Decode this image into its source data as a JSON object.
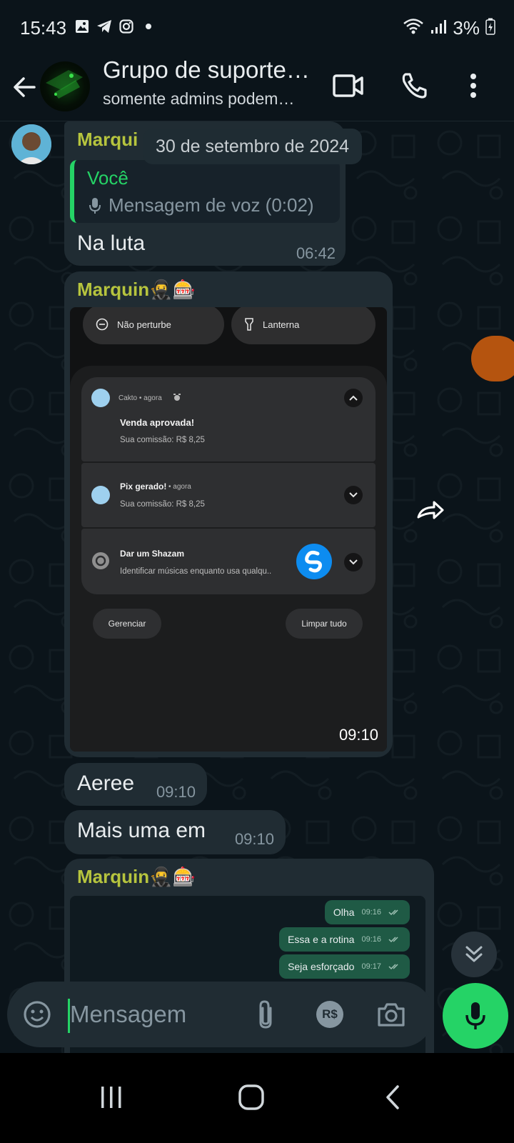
{
  "status_bar": {
    "time": "15:43",
    "battery": "3%",
    "left_icons": [
      "gallery-icon",
      "telegram-icon",
      "instagram-icon",
      "dot-icon"
    ],
    "right_icons": [
      "wifi-icon",
      "signal-icon",
      "battery-charging-icon"
    ]
  },
  "header": {
    "title": "Grupo de suporte…",
    "subtitle": "somente admins podem…",
    "actions": [
      "video-call-icon",
      "voice-call-icon",
      "more-options-icon"
    ]
  },
  "chat": {
    "date_chip": "30 de setembro de 2024",
    "msg1": {
      "sender": "Marqui",
      "quote_name": "Você",
      "quote_text": "Mensagem de voz (0:02)",
      "text": "Na luta",
      "time": "06:42"
    },
    "msg2": {
      "sender": "Marquin🥷🎰",
      "time": "09:10",
      "screenshot": {
        "tile1": "Não perturbe",
        "tile2": "Lanterna",
        "notif1_app": "Cakto • agora",
        "notif1_title": "Venda aprovada!",
        "notif1_body": "Sua comissão: R$ 8,25",
        "notif2_title": "Pix gerado!",
        "notif2_app": "• agora",
        "notif2_body": "Sua comissão: R$ 8,25",
        "notif3_title": "Dar um Shazam",
        "notif3_body": "Identificar músicas enquanto usa qualqu..",
        "manage_label": "Gerenciar",
        "clear_label": "Limpar tudo"
      }
    },
    "msg3": {
      "text": "Aeree",
      "time": "09:10"
    },
    "msg4": {
      "text": "Mais uma em",
      "time": "09:10"
    },
    "msg5": {
      "sender": "Marquin🥷🎰",
      "inner": [
        {
          "text": "Olha",
          "time": "09:16"
        },
        {
          "text": "Essa e a rotina",
          "time": "09:16"
        },
        {
          "text": "Seja esforçado",
          "time": "09:17"
        }
      ]
    }
  },
  "input": {
    "placeholder": "Mensagem",
    "icons": [
      "emoji-icon",
      "attach-icon",
      "payment-icon",
      "camera-icon",
      "mic-icon"
    ],
    "payment_label": "R$"
  },
  "colors": {
    "background": "#0b141a",
    "bubble": "#202c33",
    "sender_name": "#b6c43e",
    "accent_green": "#25d366",
    "timestamp": "#8696a0"
  }
}
